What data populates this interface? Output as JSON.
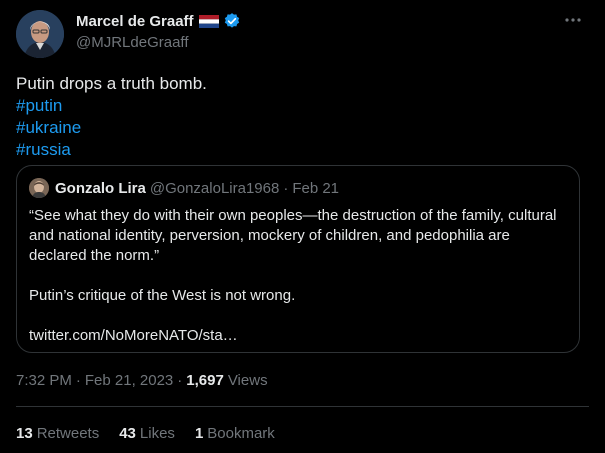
{
  "author": {
    "display_name": "Marcel de Graaff",
    "handle": "@MJRLdeGraaff",
    "flag_icon": "netherlands-flag-icon",
    "verified_icon": "verified-badge-icon"
  },
  "tweet": {
    "text": "Putin drops a truth bomb.",
    "hashtags": [
      "#putin",
      "#ukraine",
      "#russia"
    ]
  },
  "quote": {
    "display_name": "Gonzalo Lira",
    "handle": "@GonzaloLira1968",
    "separator": "·",
    "date": "Feb 21",
    "paragraph1": "“See what they do with their own peoples—the destruction of the family, cultural and national identity, perversion, mockery of children, and pedophilia are declared the norm.”",
    "paragraph2": "Putin’s critique of the West is not wrong.",
    "link": "twitter.com/NoMoreNATO/sta…"
  },
  "meta": {
    "time": "7:32 PM",
    "separator": "·",
    "date": "Feb 21, 2023",
    "separator2": "·",
    "views_count": "1,697",
    "views_label": "Views"
  },
  "stats": {
    "retweets_count": "13",
    "retweets_label": "Retweets",
    "likes_count": "43",
    "likes_label": "Likes",
    "bookmarks_count": "1",
    "bookmarks_label": "Bookmark"
  },
  "colors": {
    "background": "#000000",
    "text": "#e7e9ea",
    "muted": "#71767b",
    "link": "#1d9bf0",
    "border": "#2f3336"
  }
}
